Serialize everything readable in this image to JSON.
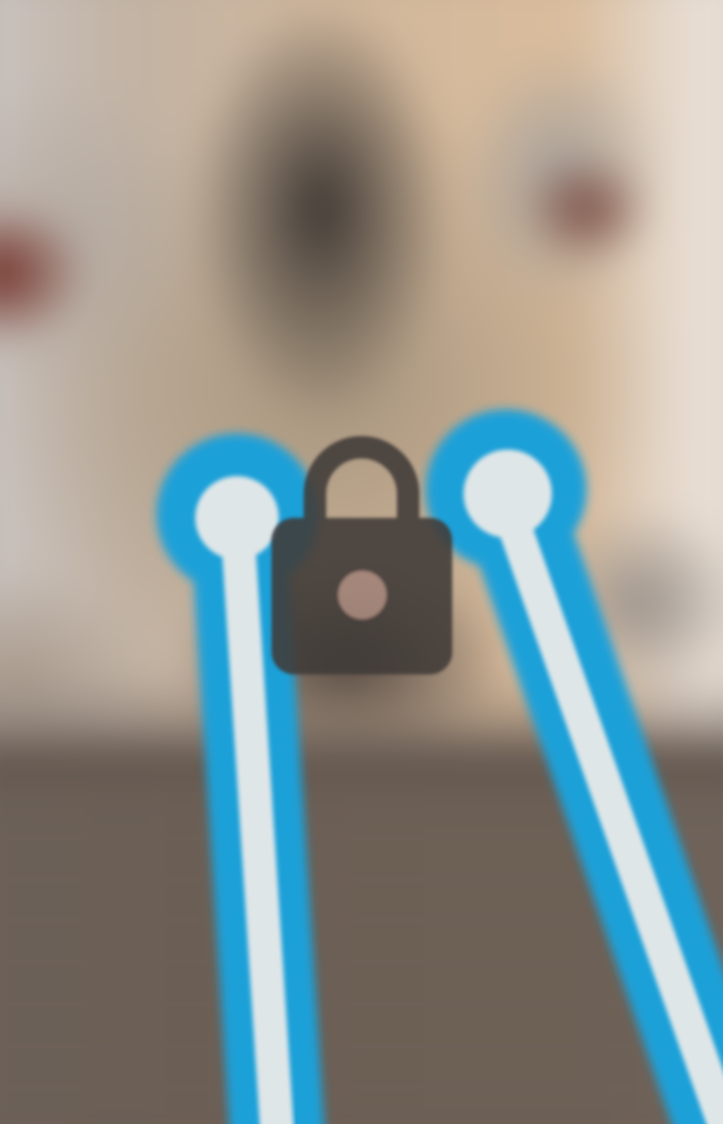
{
  "screen": {
    "type": "lock-screen",
    "wallpaper": "blurred-kitten-photo",
    "lock_icon": "lock-icon",
    "laser_beam_color": "#1aa0d8",
    "laser_core_color": "#dfe6e8",
    "lock_color": "#3f3a38",
    "keyhole_color": "#a4857a"
  }
}
